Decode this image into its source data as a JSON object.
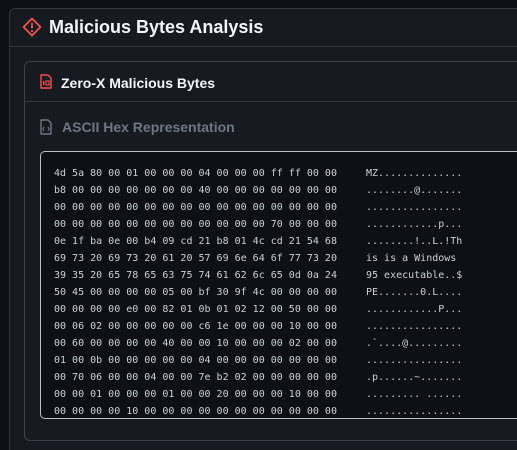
{
  "outer_panel": {
    "title": "Malicious Bytes Analysis",
    "icon": "warning-diamond-icon",
    "accent": "#f85149"
  },
  "card": {
    "title": "Zero-X Malicious Bytes",
    "icon": "binary-file-icon",
    "section": {
      "label": "ASCII Hex Representation",
      "icon": "file-code-icon"
    },
    "hex_rows": [
      {
        "hex": "4d 5a 80 00 01 00 00 00 04 00 00 00 ff ff 00 00",
        "ascii": "MZ.............."
      },
      {
        "hex": "b8 00 00 00 00 00 00 00 40 00 00 00 00 00 00 00",
        "ascii": "........@......."
      },
      {
        "hex": "00 00 00 00 00 00 00 00 00 00 00 00 00 00 00 00",
        "ascii": "................"
      },
      {
        "hex": "00 00 00 00 00 00 00 00 00 00 00 00 70 00 00 00",
        "ascii": "............p..."
      },
      {
        "hex": "0e 1f ba 0e 00 b4 09 cd 21 b8 01 4c cd 21 54 68",
        "ascii": "........!..L.!Th"
      },
      {
        "hex": "69 73 20 69 73 20 61 20 57 69 6e 64 6f 77 73 20",
        "ascii": "is is a Windows "
      },
      {
        "hex": "39 35 20 65 78 65 63 75 74 61 62 6c 65 0d 0a 24",
        "ascii": "95 executable..$"
      },
      {
        "hex": "50 45 00 00 00 00 05 00 bf 30 9f 4c 00 00 00 00",
        "ascii": "PE.......0.L...."
      },
      {
        "hex": "00 00 00 00 e0 00 82 01 0b 01 02 12 00 50 00 00",
        "ascii": "............P..."
      },
      {
        "hex": "00 06 02 00 00 00 00 00 c6 1e 00 00 00 10 00 00",
        "ascii": "................"
      },
      {
        "hex": "00 60 00 00 00 00 40 00 00 10 00 00 00 02 00 00",
        "ascii": ".`....@........."
      },
      {
        "hex": "01 00 0b 00 00 00 00 00 04 00 00 00 00 00 00 00",
        "ascii": "................"
      },
      {
        "hex": "00 70 06 00 00 04 00 00 7e b2 02 00 00 00 00 00",
        "ascii": ".p......~......."
      },
      {
        "hex": "00 00 01 00 00 00 01 00 00 20 00 00 00 10 00 00",
        "ascii": "......... ......"
      },
      {
        "hex": "00 00 00 00 10 00 00 00 00 00 00 00 00 00 00 00",
        "ascii": "................"
      }
    ]
  }
}
